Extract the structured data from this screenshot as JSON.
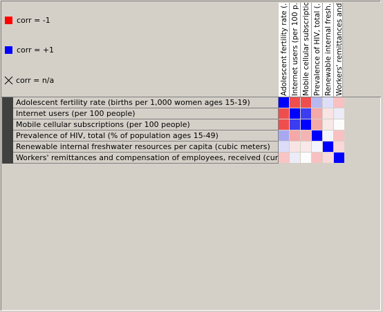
{
  "legend": {
    "neg_label": "corr = -1",
    "pos_label": "corr = +1",
    "na_label": "corr = n/a",
    "neg_color": "#ff0000",
    "pos_color": "#0000ff"
  },
  "columns": [
    {
      "label": "Adolescent fertility rate (..."
    },
    {
      "label": "Internet users (per 100 p..."
    },
    {
      "label": "Mobile cellular subscriptio..."
    },
    {
      "label": "Prevalence of HIV, total (..."
    },
    {
      "label": "Renewable internal fresh..."
    },
    {
      "label": "Workers' remittances and..."
    }
  ],
  "rows": [
    {
      "label": "Adolescent fertility rate (births per 1,000 women ages 15-19)",
      "cells": [
        "#0000ff",
        "#ef4e4e",
        "#ef4e4e",
        "#b8b8f0",
        "#dedef8",
        "#f8c0c0"
      ]
    },
    {
      "label": "Internet users (per 100 people)",
      "cells": [
        "#ef4e4e",
        "#0000ff",
        "#3c3cf0",
        "#f4a8a8",
        "#f8e4e4",
        "#ececf8"
      ]
    },
    {
      "label": "Mobile cellular subscriptions (per 100 people)",
      "cells": [
        "#ef4e4e",
        "#3c3cf0",
        "#0000ff",
        "#f4a8a8",
        "#f8e8e8",
        "#fcfcfc"
      ]
    },
    {
      "label": "Prevalence of HIV, total (% of population ages 15-49)",
      "cells": [
        "#a8a8f0",
        "#f4a8a8",
        "#f4b4b4",
        "#0000ff",
        "#f4f4fc",
        "#f8c0c0"
      ]
    },
    {
      "label": "Renewable internal freshwater resources per capita (cubic meters)",
      "cells": [
        "#dcdcf8",
        "#f8e4e4",
        "#f8e8e8",
        "#f4f4fc",
        "#0000ff",
        "#f8d8d8"
      ]
    },
    {
      "label": "Workers' remittances and compensation of employees, received (current US$)",
      "cells": [
        "#f8c4c4",
        "#ececf8",
        "#fcfcfc",
        "#f8c0c0",
        "#f8d8d8",
        "#0000ff"
      ]
    }
  ]
}
